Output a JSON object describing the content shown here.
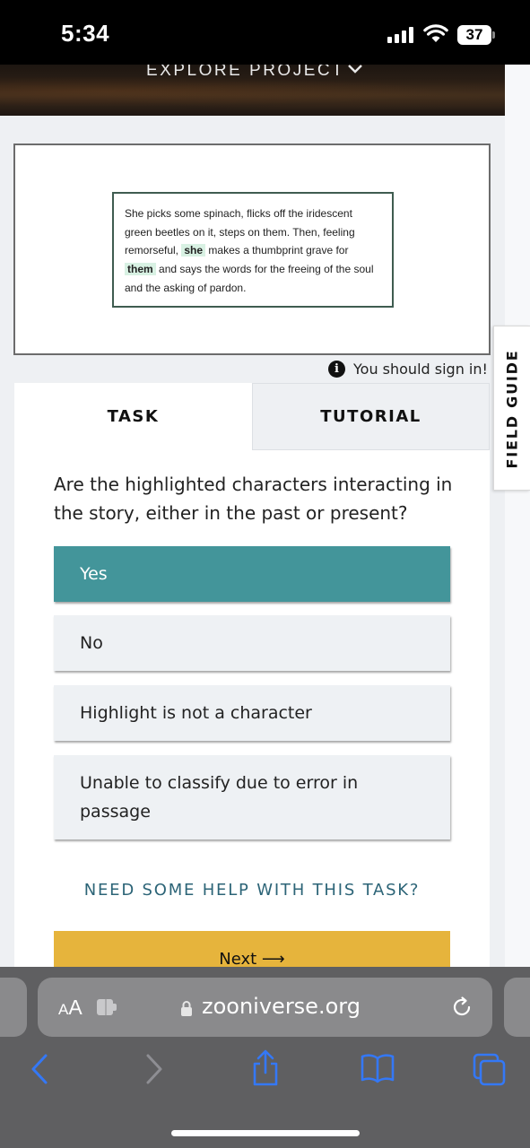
{
  "status_bar": {
    "time": "5:34",
    "battery": "37"
  },
  "header": {
    "explore_label": "EXPLORE PROJECT"
  },
  "subject": {
    "passage": {
      "part1": "She picks some spinach, flicks off the iridescent green beetles on it, steps on them. Then, feeling remorseful,",
      "highlight1": "she",
      "part2": "makes a thumbprint grave for",
      "highlight2": "them",
      "part3": "and says the words for the freeing of the soul and the asking of pardon."
    },
    "signin_notice": "You should sign in!"
  },
  "tabs": {
    "task": "TASK",
    "tutorial": "TUTORIAL"
  },
  "task": {
    "question": "Are the highlighted characters interacting in the story, either in the past or present?",
    "answers": [
      {
        "label": "Yes",
        "selected": true
      },
      {
        "label": "No",
        "selected": false
      },
      {
        "label": "Highlight is not a character",
        "selected": false
      },
      {
        "label": "Unable to classify due to error in passage",
        "selected": false
      }
    ],
    "help_link": "NEED SOME HELP WITH THIS TASK?",
    "next_label": "Next ⟶"
  },
  "field_guide": {
    "label": "FIELD GUIDE"
  },
  "browser": {
    "aa_small": "A",
    "aa_big": "A",
    "url": "zooniverse.org"
  },
  "icons": {
    "signal": "cellular-signal-icon",
    "wifi": "wifi-icon",
    "info": "info-icon",
    "chevron": "chevron-down-icon",
    "lock": "lock-icon",
    "reload": "reload-icon",
    "back": "back-arrow-icon",
    "forward": "forward-arrow-icon",
    "share": "share-icon",
    "bookmarks": "bookmarks-icon",
    "tabs": "tabs-icon"
  },
  "colors": {
    "selected_answer": "#43959a",
    "next_button": "#e6b43c",
    "help_link": "#2c6477",
    "highlight": "#d8f1e3",
    "passage_border": "#3f5c50",
    "safari_blue": "#3478f6"
  }
}
